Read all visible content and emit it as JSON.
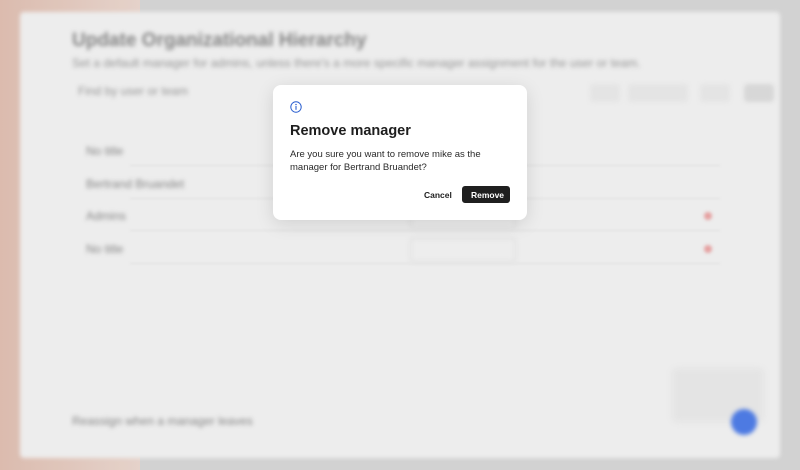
{
  "background": {
    "page_title": "Update Organizational Hierarchy",
    "page_subtitle": "Set a default manager for admins, unless there's a more specific manager assignment for the user or team.",
    "search_text": "Find by user or team",
    "rows": [
      "No title",
      "Bertrand Bruandet",
      "Admins",
      "No title"
    ],
    "footer_text": "Reassign when a manager leaves"
  },
  "dialog": {
    "icon": "info-icon",
    "title": "Remove manager",
    "body": "Are you sure you want to remove mike as the manager for Bertrand Bruandet?",
    "cancel_label": "Cancel",
    "remove_label": "Remove",
    "remove_icon": "check-icon"
  },
  "colors": {
    "primary_button": "#1f1f1f",
    "info_icon": "#2b5fd0",
    "fab": "#3e6fe0",
    "remove_accent": "#e39a9a"
  }
}
